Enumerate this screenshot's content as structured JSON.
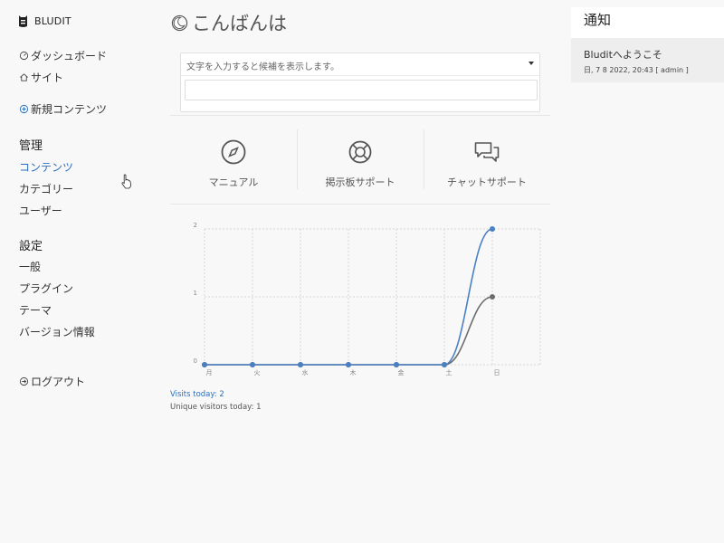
{
  "brand": {
    "name": "BLUDIT"
  },
  "sidebar": {
    "dashboard": "ダッシュボード",
    "site": "サイト",
    "new_content": "新規コンテンツ",
    "manage_heading": "管理",
    "content": "コンテンツ",
    "categories": "カテゴリー",
    "users": "ユーザー",
    "settings_heading": "設定",
    "general": "一般",
    "plugins": "プラグイン",
    "themes": "テーマ",
    "about": "バージョン情報",
    "logout": "ログアウト"
  },
  "greeting": "こんばんは",
  "search": {
    "placeholder": "文字を入力すると候補を表示します。"
  },
  "support": [
    {
      "label": "マニュアル",
      "icon": "compass-icon"
    },
    {
      "label": "掲示板サポート",
      "icon": "lifebuoy-icon"
    },
    {
      "label": "チャットサポート",
      "icon": "chat-icon"
    }
  ],
  "stats": {
    "visits_today": "Visits today: 2",
    "unique_today": "Unique visitors today: 1"
  },
  "notifications": {
    "title": "通知",
    "items": [
      {
        "title": "Bluditへようこそ",
        "meta": "日, 7 8 2022, 20:43 [ admin ]"
      }
    ]
  },
  "colors": {
    "accent": "#2a6ebb",
    "visits_line": "#4a7fc1",
    "unique_line": "#6d6d6d"
  },
  "chart_data": {
    "type": "line",
    "categories": [
      "月",
      "火",
      "水",
      "木",
      "金",
      "土",
      "日"
    ],
    "series": [
      {
        "values": [
          0,
          0,
          0,
          0,
          0,
          0,
          2
        ],
        "color": "#4a7fc1"
      },
      {
        "values": [
          0,
          0,
          0,
          0,
          0,
          0,
          1
        ],
        "color": "#6d6d6d"
      }
    ],
    "ylim": [
      0,
      2
    ],
    "yticks": [
      0,
      1,
      2
    ],
    "grid": true
  }
}
